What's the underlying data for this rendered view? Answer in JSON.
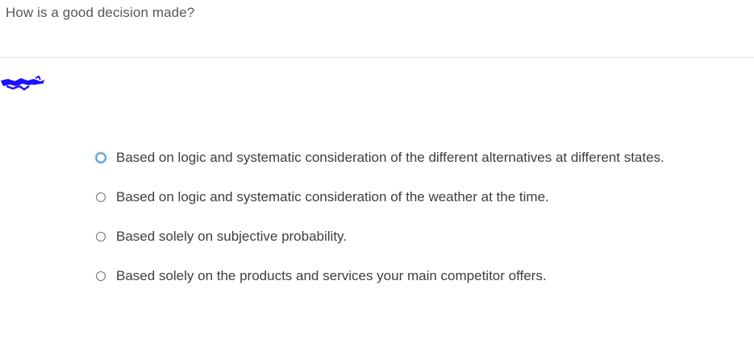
{
  "question": {
    "text": "How is a good decision made?"
  },
  "options": [
    {
      "label": "Based on logic and systematic consideration of the different alternatives at different states.",
      "focused": true
    },
    {
      "label": "Based on logic and systematic consideration of the weather at the time.",
      "focused": false
    },
    {
      "label": "Based solely on subjective probability.",
      "focused": false
    },
    {
      "label": "Based solely on the products and services your main competitor offers.",
      "focused": false
    }
  ],
  "colors": {
    "focus_ring": "#2d7fc4",
    "scribble": "#1a12ff",
    "text": "#3b3f42"
  }
}
